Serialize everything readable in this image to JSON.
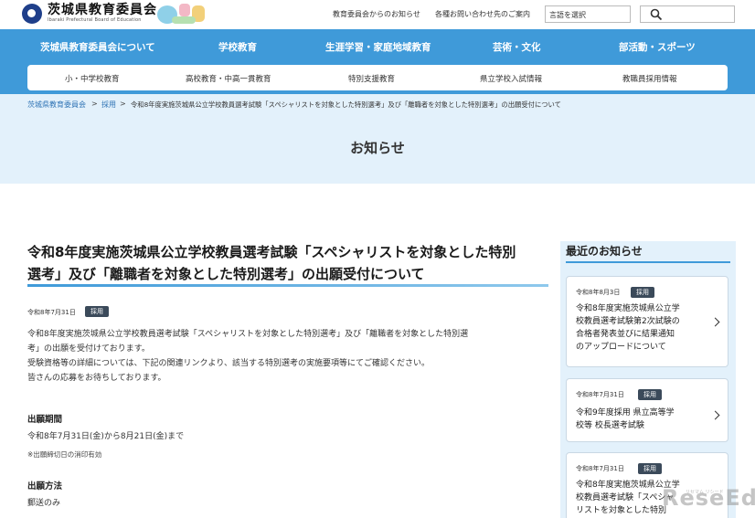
{
  "header": {
    "logo_name": "茨城県教育委員会",
    "logo_en": "Ibaraki Prefectural Board of Education",
    "util_links": [
      "教育委員会からのお知らせ",
      "各種お問い合わせ先のご案内"
    ],
    "language_select": "言語を選択"
  },
  "main_nav": [
    "茨城県教育委員会について",
    "学校教育",
    "生涯学習・家庭地域教育",
    "芸術・文化",
    "部活動・スポーツ"
  ],
  "sub_nav": [
    "小・中学校教育",
    "高校教育・中高一貫教育",
    "特別支援教育",
    "県立学校入試情報",
    "教職員採用情報"
  ],
  "breadcrumb": {
    "items": [
      "茨城県教育委員会",
      "採用"
    ],
    "separator": ">",
    "current": "令和8年度実施茨城県公立学校教員選考試験「スペシャリストを対象とした特別選考」及び「離職者を対象とした特別選考」の出願受付について"
  },
  "page_heading": "お知らせ",
  "article": {
    "title_line1": "令和8年度実施茨城県公立学校教員選考試験「スペシャリストを対象とした特別",
    "title_line2": "選考」及び「離職者を対象とした特別選考」の出願受付について",
    "date": "令和8年7月31日",
    "tag": "採用",
    "para1_line1": "令和8年度実施茨城県公立学校教員選考試験「スペシャリストを対象とした特別選考」及び「離職者を対象とした特別選",
    "para1_line2": "考」の出願を受付けております。",
    "para2": "受験資格等の詳細については、下記の関連リンクより、該当する特別選考の実施要項等にてご確認ください。",
    "para3": "皆さんの応募をお待ちしております。",
    "period_heading": "出願期間",
    "period_text": "令和8年7月31日(金)から8月21日(金)まで",
    "period_note": "※出願締切日の消印有効",
    "method_heading": "出願方法",
    "method_text": "郵送のみ"
  },
  "sidebar": {
    "title": "最近のお知らせ",
    "cards": [
      {
        "date": "令和8年8月3日",
        "tag": "採用",
        "lines": [
          "令和8年度実施茨城県公立学",
          "校教員選考試験第2次試験の",
          "合格者発表並びに結果通知",
          "のアップロードについて"
        ]
      },
      {
        "date": "令和8年7月31日",
        "tag": "採用",
        "lines": [
          "令和9年度採用 県立高等学",
          "校等 校長選考試験"
        ]
      },
      {
        "date": "令和8年7月31日",
        "tag": "採用",
        "lines": [
          "令和8年度実施茨城県公立学",
          "校教員選考試験「スペシャ",
          "リストを対象とした特別"
        ]
      }
    ]
  },
  "watermark": {
    "text": "ReseEd",
    "sub": "リセマム リシード"
  },
  "colors": {
    "nav_blue": "#3f9ad9",
    "light_blue": "#e3f1fb",
    "tag_dark": "#3b4a5a",
    "link_blue": "#2f74b5"
  }
}
